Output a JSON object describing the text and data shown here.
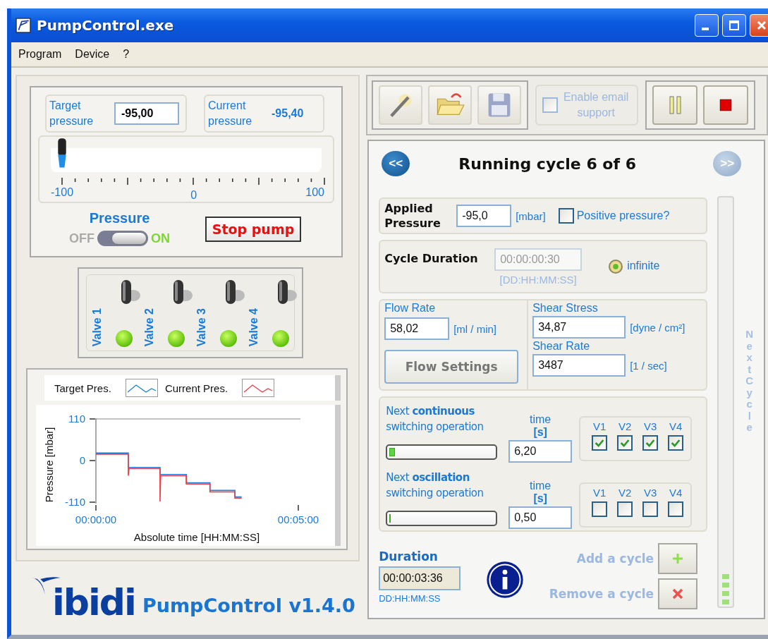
{
  "window": {
    "title": "PumpControl.exe"
  },
  "menu": [
    "Program",
    "Device",
    "?"
  ],
  "pressure": {
    "target_label": "Target pressure",
    "target_value": "-95,00",
    "current_label": "Current pressure",
    "current_value": "-95,40",
    "slider": {
      "level": 0.025
    },
    "scale": [
      "-100",
      "0",
      "100"
    ],
    "switch_label": "Pressure",
    "off_label": "OFF",
    "on_label": "ON",
    "on": true,
    "stop_button": "Stop pump"
  },
  "valves": [
    {
      "label": "Valve 1",
      "on": true
    },
    {
      "label": "Valve 2",
      "on": true
    },
    {
      "label": "Valve 3",
      "on": true
    },
    {
      "label": "Valve 4",
      "on": true
    }
  ],
  "chart": {
    "chart_data": {
      "type": "line",
      "xlabel": "Absolute time [HH:MM:SS]",
      "ylabel": "Pressure [mbar]",
      "x": [
        0,
        48,
        48,
        49,
        95,
        95,
        96,
        134,
        134,
        169,
        169,
        206,
        206,
        216
      ],
      "xlim": [
        0,
        300
      ],
      "ylim": [
        -110,
        110
      ],
      "xticks": [
        {
          "value": 0,
          "label": "00:00:00"
        },
        {
          "value": 300,
          "label": "00:05:00"
        }
      ],
      "yticks": [
        110,
        0,
        -110
      ],
      "series": [
        {
          "name": "Target Pres.",
          "color": "#1f7fd8",
          "values": [
            20,
            20,
            -18,
            -18,
            -18,
            -37,
            -37,
            -37,
            -59,
            -59,
            -79,
            -79,
            -96,
            -96
          ]
        },
        {
          "name": "Current Pres.",
          "color": "#f03c46",
          "values": [
            17,
            17,
            -40,
            -21,
            -21,
            -108,
            -40,
            -40,
            -62,
            -62,
            -83,
            -83,
            -99,
            -99
          ]
        }
      ]
    }
  },
  "logo": {
    "brand": "ibidi",
    "product": "PumpControl v1.4.0"
  },
  "email": {
    "label": "Enable email support",
    "checked": false,
    "disabled": true
  },
  "cycle": {
    "title": "Running cycle 6 of 6",
    "prev": {
      "label": "<<",
      "disabled": false
    },
    "next": {
      "label": ">>",
      "disabled": true
    }
  },
  "applied": {
    "label": "Applied Pressure",
    "value": "-95,0",
    "unit": "[mbar]",
    "positive_label": "Positive pressure?",
    "positive_checked": false
  },
  "cycle_duration": {
    "label": "Cycle Duration",
    "value": "00:00:00:30",
    "format": "[DD:HH:MM:SS]",
    "disabled": true,
    "infinite_label": "infinite",
    "infinite_selected": true
  },
  "flow": {
    "rate_label": "Flow Rate",
    "rate": "58,02",
    "rate_unit": "[ml / min]",
    "button": "Flow Settings",
    "stress_label": "Shear Stress",
    "stress": "34,87",
    "stress_unit": "[dyne / cm²]",
    "shear_rate_label": "Shear Rate",
    "shear_rate": "3487",
    "shear_rate_unit": "[1 / sec]"
  },
  "switching": [
    {
      "title": "Next **continuous** switching operation",
      "time_label": "time",
      "time_unit": "[s]",
      "level": 0.05,
      "time": "6,20",
      "valves": [
        {
          "label": "V1",
          "checked": true
        },
        {
          "label": "V2",
          "checked": true
        },
        {
          "label": "V3",
          "checked": true
        },
        {
          "label": "V4",
          "checked": true
        }
      ]
    },
    {
      "title": "Next **oscillation** switching operation",
      "time_label": "time",
      "time_unit": "[s]",
      "level": 0,
      "time": "0,50",
      "valves": [
        {
          "label": "V1",
          "checked": false
        },
        {
          "label": "V2",
          "checked": false
        },
        {
          "label": "V3",
          "checked": false
        },
        {
          "label": "V4",
          "checked": false
        }
      ]
    }
  ],
  "duration": {
    "label": "Duration",
    "value": "00:00:03:36",
    "format": "DD:HH:MM:SS"
  },
  "add_cycle": {
    "label": "Add a cycle",
    "disabled": true
  },
  "remove_cycle": {
    "label": "Remove a cycle",
    "disabled": true
  },
  "next_cycle": {
    "label": "Next Cycle",
    "disabled": true
  },
  "cycle_progress": {
    "level": 0.08
  }
}
